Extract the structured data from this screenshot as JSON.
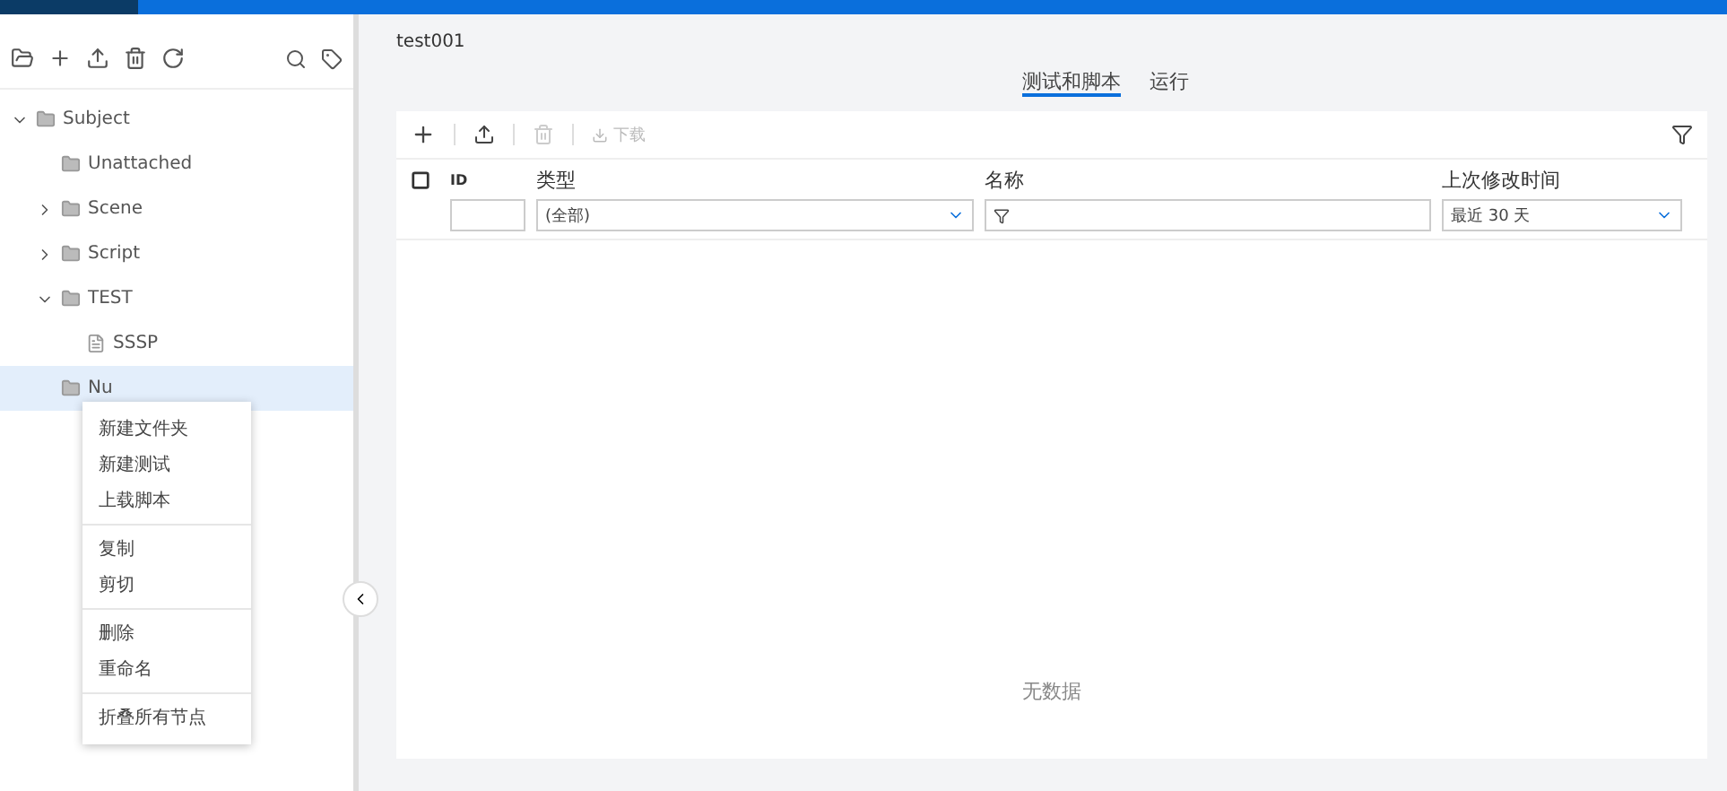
{
  "tree": [
    {
      "label": "Subject",
      "kind": "folder",
      "expanded": true,
      "selected": false,
      "children": [
        {
          "label": "Unattached",
          "kind": "folder",
          "selected": false
        },
        {
          "label": "Scene",
          "kind": "folder",
          "expanded": false,
          "selected": false
        },
        {
          "label": "Script",
          "kind": "folder",
          "expanded": false,
          "selected": false
        },
        {
          "label": "TEST",
          "kind": "folder",
          "expanded": true,
          "selected": false,
          "children": [
            {
              "label": "SSSP",
              "kind": "script",
              "selected": false
            }
          ]
        },
        {
          "label": "Nu",
          "kind": "folder",
          "selected": true
        }
      ]
    }
  ],
  "context_menu": [
    [
      "新建文件夹",
      "新建测试",
      "上载脚本"
    ],
    [
      "复制",
      "剪切"
    ],
    [
      "删除",
      "重命名"
    ],
    [
      "折叠所有节点"
    ]
  ],
  "breadcrumb": "test001",
  "tabs": [
    {
      "label": "测试和脚本",
      "selected": true
    },
    {
      "label": "运行",
      "selected": false
    }
  ],
  "toolbar": {
    "download": "下载"
  },
  "table": {
    "select_all_checked": false,
    "columns": [
      "ID",
      "类型",
      "名称",
      "上次修改时间"
    ],
    "type_filter": "(全部)",
    "date_filter": "最近 30 天",
    "empty": "无数据"
  }
}
